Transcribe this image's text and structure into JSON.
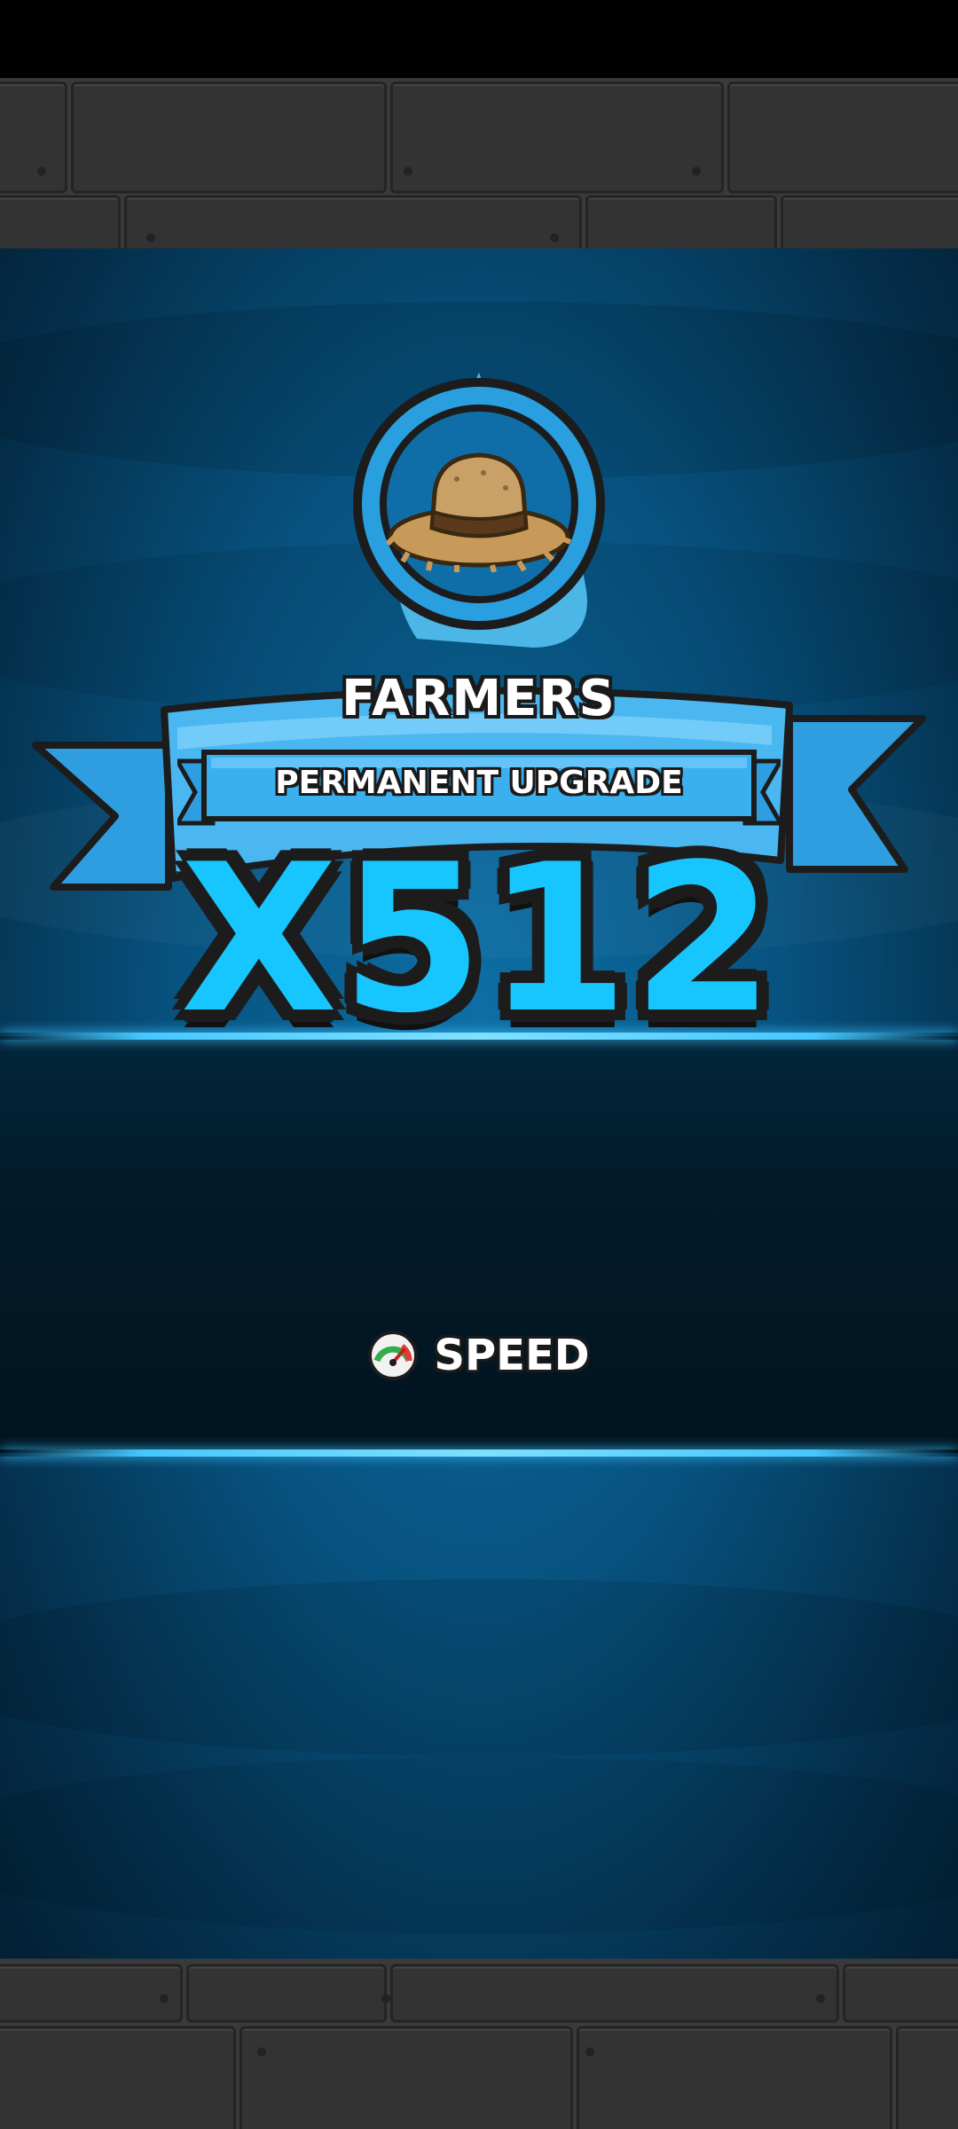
{
  "upgrade": {
    "title": "FARMERS",
    "banner": "PERMANENT UPGRADE",
    "multiplier": "X512",
    "stat_label": "SPEED",
    "stat_icon": "speedometer-icon",
    "emblem_icon": "straw-hat-icon"
  },
  "colors": {
    "accent": "#18c6ff",
    "ribbon": "#3fb3f0",
    "panel": "#07527f"
  }
}
